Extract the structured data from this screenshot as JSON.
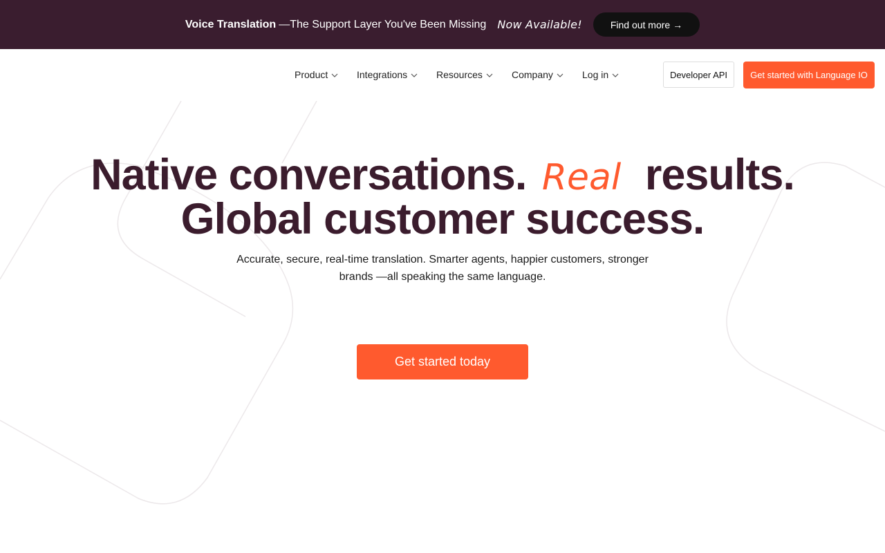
{
  "announcement": {
    "title": "Voice Translation",
    "text": "—The Support Layer You've Been Missing",
    "badge": "Now Available!",
    "cta": "Find out more →"
  },
  "nav": {
    "items": [
      {
        "label": "Product",
        "icon": "chevron-down-icon"
      },
      {
        "label": "Integrations",
        "icon": "chevron-down-icon"
      },
      {
        "label": "Resources",
        "icon": "chevron-down-icon"
      },
      {
        "label": "Company",
        "icon": "chevron-down-icon"
      },
      {
        "label": "Log in",
        "icon": "chevron-down-icon"
      }
    ],
    "developer_api": "Developer API",
    "get_started": "Get started with Language IO"
  },
  "hero": {
    "line1_start": "Native conversations.",
    "line1_accent": "Real",
    "line1_end": "results.",
    "line2": "Global customer success.",
    "subtitle": "Accurate, secure, real-time translation. Smarter agents, happier customers, stronger brands —all speaking the same language.",
    "cta": "Get started today"
  },
  "colors": {
    "announcement_bg": "#3a1d2f",
    "heading": "#3b1c2d",
    "accent": "#ff5a2e"
  }
}
